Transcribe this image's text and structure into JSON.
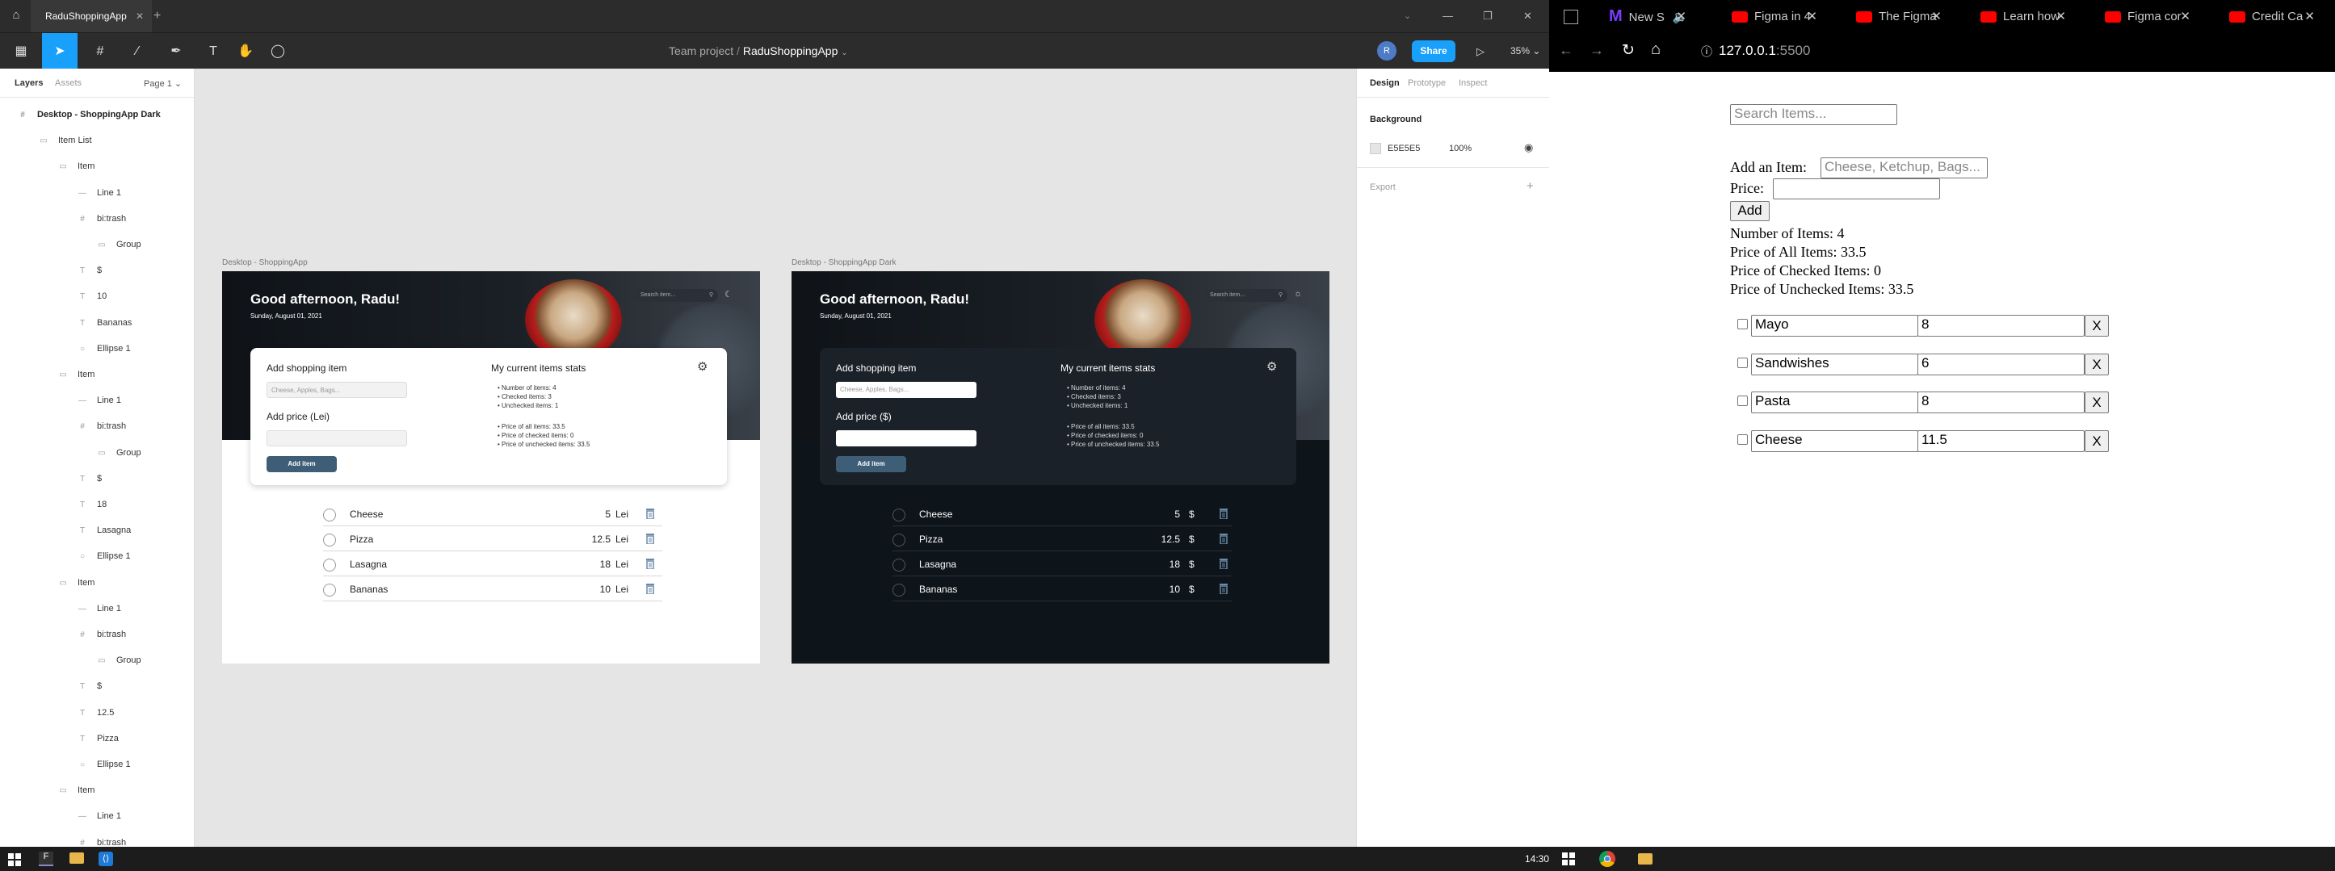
{
  "figma": {
    "tab_title": "RaduShoppingApp",
    "breadcrumb_team": "Team project",
    "breadcrumb_sep": "/",
    "file_name": "RaduShoppingApp",
    "share": "Share",
    "zoom": "35%",
    "avatar": "R",
    "layers_tab": "Layers",
    "assets_tab": "Assets",
    "page": "Page 1",
    "layers": [
      {
        "label": "Desktop - ShoppingApp Dark",
        "indent": 0,
        "icon": "#"
      },
      {
        "label": "Item List",
        "indent": 1,
        "icon": "▭"
      },
      {
        "label": "Item",
        "indent": 2,
        "icon": "▭"
      },
      {
        "label": "Line 1",
        "indent": 3,
        "icon": "—"
      },
      {
        "label": "bi:trash",
        "indent": 3,
        "icon": "#"
      },
      {
        "label": "Group",
        "indent": 4,
        "icon": "▭"
      },
      {
        "label": "$",
        "indent": 3,
        "icon": "T"
      },
      {
        "label": "10",
        "indent": 3,
        "icon": "T"
      },
      {
        "label": "Bananas",
        "indent": 3,
        "icon": "T"
      },
      {
        "label": "Ellipse 1",
        "indent": 3,
        "icon": "○"
      },
      {
        "label": "Item",
        "indent": 2,
        "icon": "▭"
      },
      {
        "label": "Line 1",
        "indent": 3,
        "icon": "—"
      },
      {
        "label": "bi:trash",
        "indent": 3,
        "icon": "#"
      },
      {
        "label": "Group",
        "indent": 4,
        "icon": "▭"
      },
      {
        "label": "$",
        "indent": 3,
        "icon": "T"
      },
      {
        "label": "18",
        "indent": 3,
        "icon": "T"
      },
      {
        "label": "Lasagna",
        "indent": 3,
        "icon": "T"
      },
      {
        "label": "Ellipse 1",
        "indent": 3,
        "icon": "○"
      },
      {
        "label": "Item",
        "indent": 2,
        "icon": "▭"
      },
      {
        "label": "Line 1",
        "indent": 3,
        "icon": "—"
      },
      {
        "label": "bi:trash",
        "indent": 3,
        "icon": "#"
      },
      {
        "label": "Group",
        "indent": 4,
        "icon": "▭"
      },
      {
        "label": "$",
        "indent": 3,
        "icon": "T"
      },
      {
        "label": "12.5",
        "indent": 3,
        "icon": "T"
      },
      {
        "label": "Pizza",
        "indent": 3,
        "icon": "T"
      },
      {
        "label": "Ellipse 1",
        "indent": 3,
        "icon": "○"
      },
      {
        "label": "Item",
        "indent": 2,
        "icon": "▭"
      },
      {
        "label": "Line 1",
        "indent": 3,
        "icon": "—"
      },
      {
        "label": "bi:trash",
        "indent": 3,
        "icon": "#"
      }
    ],
    "right": {
      "tabs": [
        "Design",
        "Prototype",
        "Inspect"
      ],
      "background_label": "Background",
      "bg_hex": "E5E5E5",
      "bg_opacity": "100%",
      "export_label": "Export"
    },
    "light_frame": {
      "label": "Desktop - ShoppingApp",
      "greeting": "Good afternoon, Radu!",
      "date": "Sunday, August 01, 2021",
      "search_placeholder": "Search item...",
      "add_title": "Add shopping item",
      "item_placeholder": "Cheese, Apples, Bags...",
      "price_label": "Add price (Lei)",
      "add_button": "Add item",
      "stats_title": "My current items stats",
      "stats": [
        "Number of items: 4",
        "Checked items: 3",
        "Unchecked items: 1"
      ],
      "stats2": [
        "Price of all items: 33.5",
        "Price of checked items: 0",
        "Price of unchecked items: 33.5"
      ],
      "items": [
        {
          "name": "Cheese",
          "price": "5",
          "cur": "Lei"
        },
        {
          "name": "Pizza",
          "price": "12.5",
          "cur": "Lei"
        },
        {
          "name": "Lasagna",
          "price": "18",
          "cur": "Lei"
        },
        {
          "name": "Bananas",
          "price": "10",
          "cur": "Lei"
        }
      ]
    },
    "dark_frame": {
      "label": "Desktop - ShoppingApp Dark",
      "greeting": "Good afternoon, Radu!",
      "date": "Sunday, August 01, 2021",
      "search_placeholder": "Search item...",
      "add_title": "Add shopping item",
      "item_placeholder": "Cheese, Apples, Bags...",
      "price_label": "Add price ($)",
      "add_button": "Add item",
      "stats_title": "My current items stats",
      "stats": [
        "Number of items: 4",
        "Checked items: 3",
        "Unchecked items: 1"
      ],
      "stats2": [
        "Price of all items: 33.5",
        "Price of checked items: 0",
        "Price of unchecked items: 33.5"
      ],
      "items": [
        {
          "name": "Cheese",
          "price": "5",
          "cur": "$"
        },
        {
          "name": "Pizza",
          "price": "12.5",
          "cur": "$"
        },
        {
          "name": "Lasagna",
          "price": "18",
          "cur": "$"
        },
        {
          "name": "Bananas",
          "price": "10",
          "cur": "$"
        }
      ]
    },
    "help": "?"
  },
  "browser": {
    "tabs": [
      "",
      "New S",
      "Figma in 4",
      "The Figma",
      "Learn how",
      "Figma cor",
      "Credit Ca"
    ],
    "url_host": "127.0.0.1",
    "url_port": ":5500",
    "page": {
      "search_placeholder": "Search Items...",
      "add_label": "Add an Item:",
      "add_placeholder": "Cheese, Ketchup, Bags...",
      "price_label": "Price:",
      "add_button": "Add",
      "stats": [
        "Number of Items: 4",
        "Price of All Items: 33.5",
        "Price of Checked Items: 0",
        "Price of Unchecked Items: 33.5"
      ],
      "items": [
        {
          "name": "Mayo",
          "price": "8"
        },
        {
          "name": "Sandwishes",
          "price": "6"
        },
        {
          "name": "Pasta",
          "price": "8"
        },
        {
          "name": "Cheese",
          "price": "11.5"
        }
      ],
      "remove": "X"
    }
  },
  "taskbar": {
    "time": "14:30"
  }
}
